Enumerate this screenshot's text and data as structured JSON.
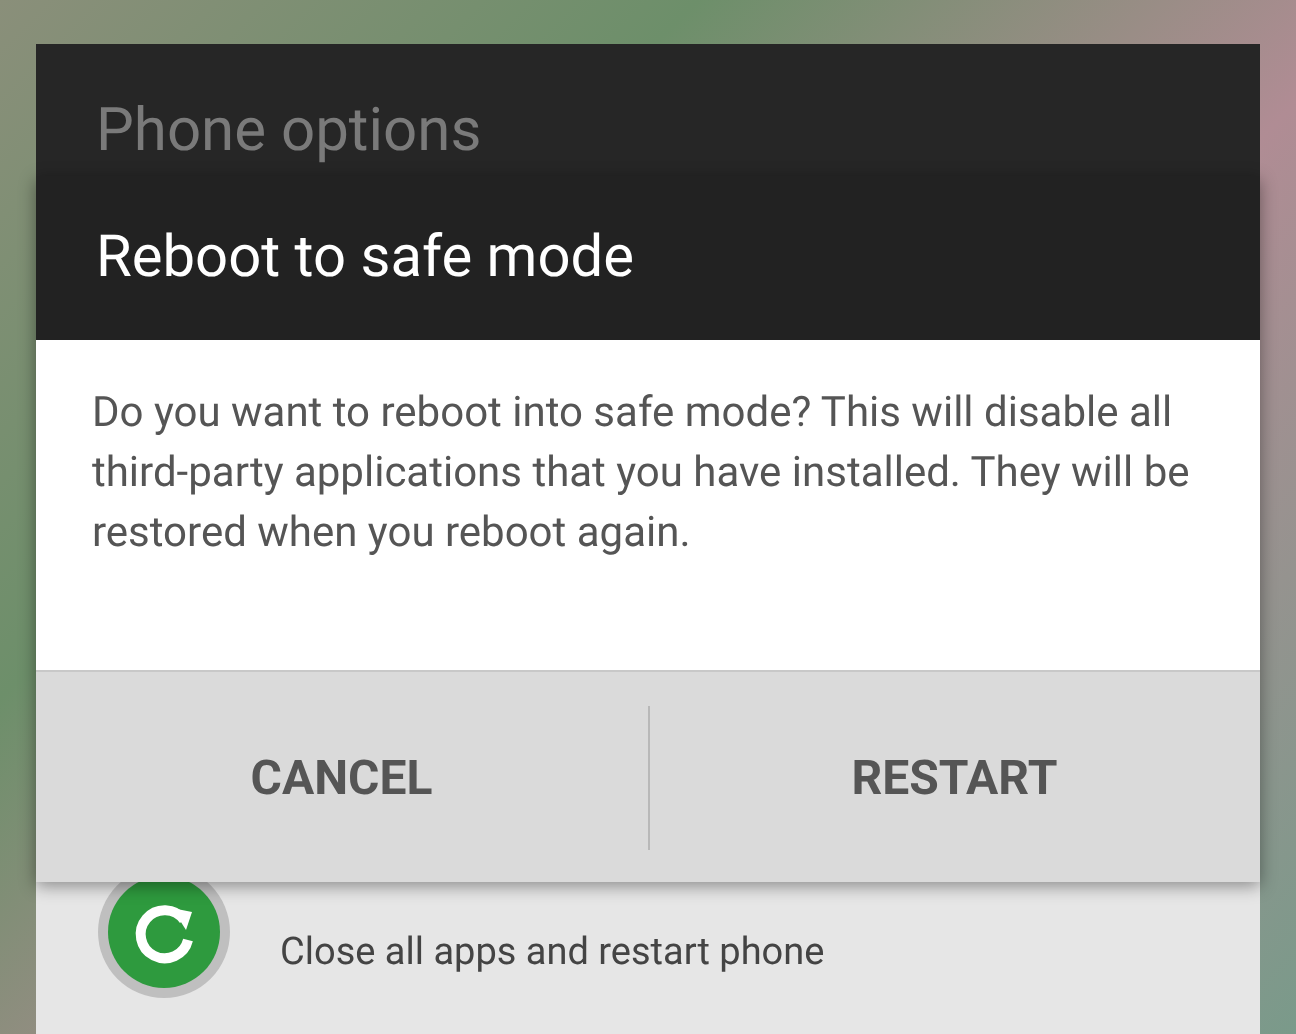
{
  "back_dialog": {
    "title": "Phone options",
    "item": {
      "subtitle": "Close all apps and restart phone"
    }
  },
  "dialog": {
    "title": "Reboot to safe mode",
    "message": "Do you want to reboot into safe mode? This will disable all third-party applications that you have installed. They will be restored when you reboot again.",
    "buttons": [
      "CANCEL",
      "RESTART"
    ]
  }
}
